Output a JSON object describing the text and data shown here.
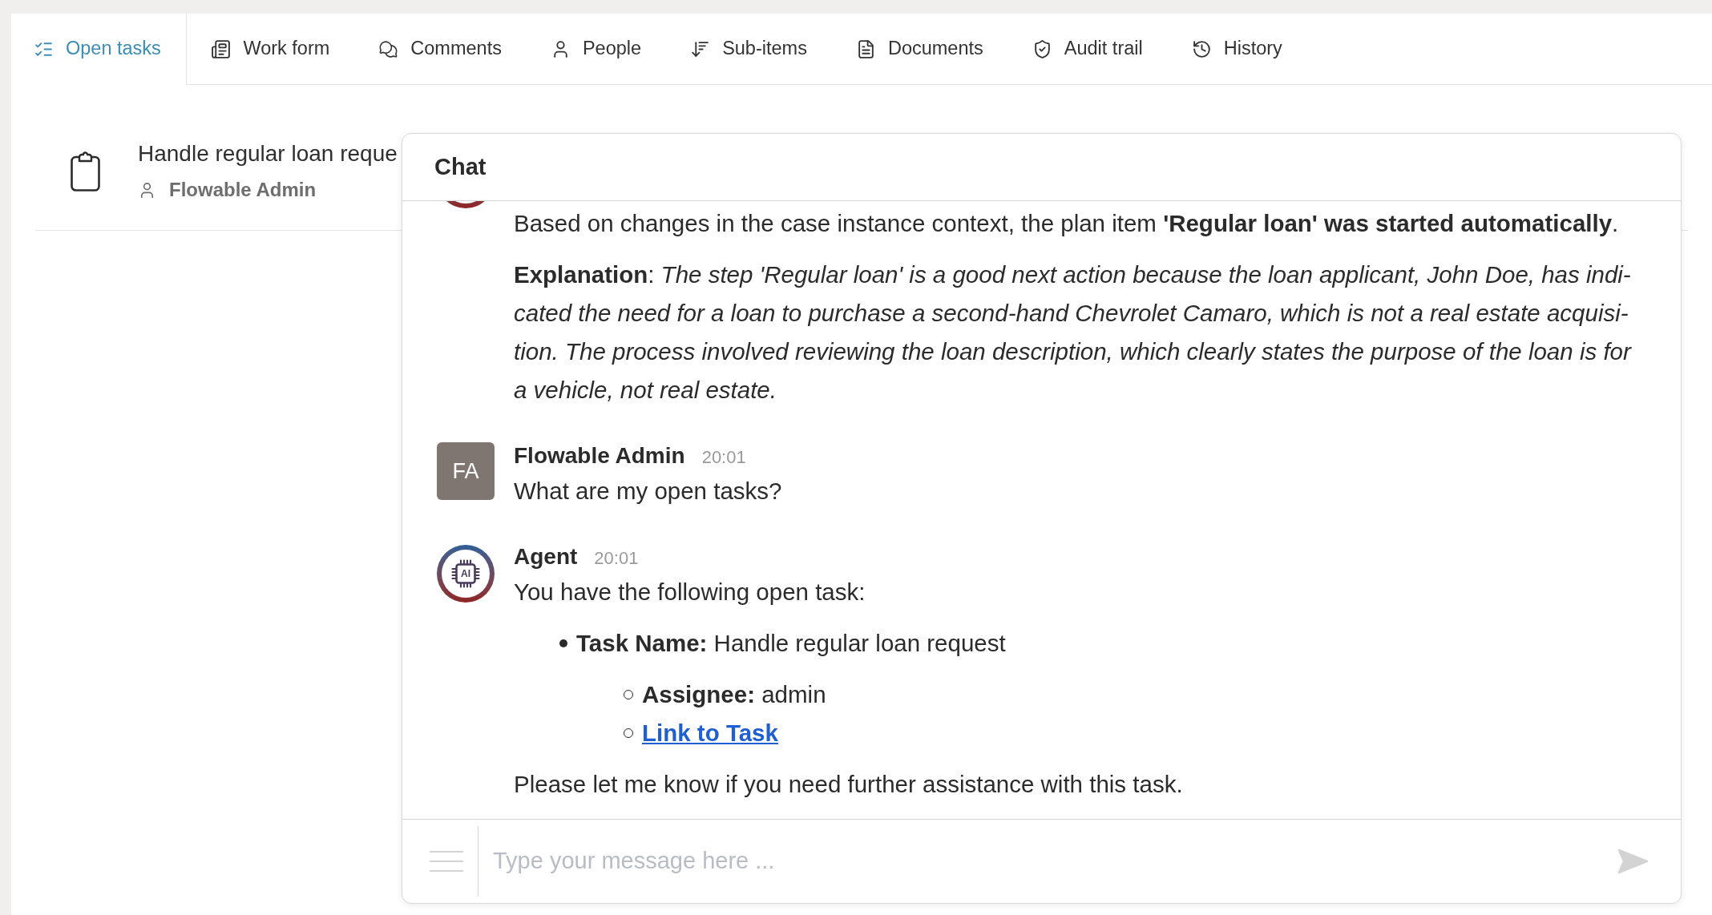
{
  "tabs": [
    {
      "label": "Open tasks",
      "selected": true
    },
    {
      "label": "Work form",
      "selected": false
    },
    {
      "label": "Comments",
      "selected": false
    },
    {
      "label": "People",
      "selected": false
    },
    {
      "label": "Sub-items",
      "selected": false
    },
    {
      "label": "Documents",
      "selected": false
    },
    {
      "label": "Audit trail",
      "selected": false
    },
    {
      "label": "History",
      "selected": false
    }
  ],
  "task_list": {
    "items": [
      {
        "title": "Handle regular loan reque",
        "assignee": "Flowable Admin"
      }
    ]
  },
  "chat": {
    "title": "Chat",
    "messages": [
      {
        "kind": "agent_continued",
        "blocks": [
          {
            "kind": "paragraph",
            "text": "Based on changes in the case instance context, the plan item **'Regular loan' was started automatically**."
          },
          {
            "kind": "paragraph",
            "text": "**Explanation**: *The step 'Regular loan' is a good next action because the loan applicant, John Doe, has indi-cated the need for a loan to purchase a second-hand Chevrolet Camaro, which is not a real estate acquisi-tion. The process involved reviewing the loan description, which clearly states the purpose of the loan is for a vehicle, not real estate.*"
          }
        ]
      },
      {
        "kind": "user",
        "author": "Flowable Admin",
        "avatar_text": "FA",
        "time": "20:01",
        "blocks": [
          {
            "kind": "paragraph",
            "text": "What are my open tasks?"
          }
        ]
      },
      {
        "kind": "agent",
        "author": "Agent",
        "avatar_text": "AI",
        "time": "20:01",
        "blocks": [
          {
            "kind": "paragraph",
            "text": "You have the following open task:"
          },
          {
            "kind": "list",
            "items": [
              {
                "kind": "text",
                "text": "**Task Name:** Handle regular loan request",
                "children": [
                  {
                    "kind": "text",
                    "text": "**Assignee:** admin"
                  },
                  {
                    "kind": "link",
                    "text": "Link to Task"
                  }
                ]
              }
            ]
          },
          {
            "kind": "paragraph",
            "text": "Please let me know if you need further assistance with this task."
          }
        ]
      }
    ],
    "input": {
      "placeholder": "Type your message here ..."
    }
  }
}
